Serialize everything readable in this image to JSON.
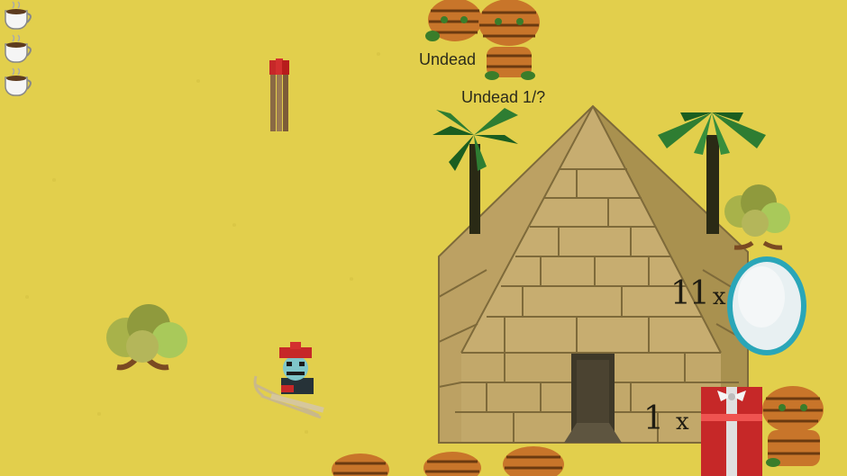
{
  "hud": {
    "lives": [
      {
        "icon": "coffee-cup-icon"
      },
      {
        "icon": "coffee-cup-icon"
      },
      {
        "icon": "coffee-cup-icon"
      }
    ]
  },
  "enemies": {
    "labels": [
      "Undead",
      "Undead 1/?"
    ]
  },
  "inventory": {
    "orb_count": "11",
    "orb_multiplier": "x",
    "gift_count": "1",
    "gift_multiplier": "x"
  },
  "colors": {
    "sand": "#e2cf4c",
    "pyramid": "#c4ab6a",
    "palm_leaves": "#2e7d32",
    "mummy_wrap": "#c8752a",
    "gift_red": "#c62828",
    "orb_ring": "#2aa6b8"
  }
}
